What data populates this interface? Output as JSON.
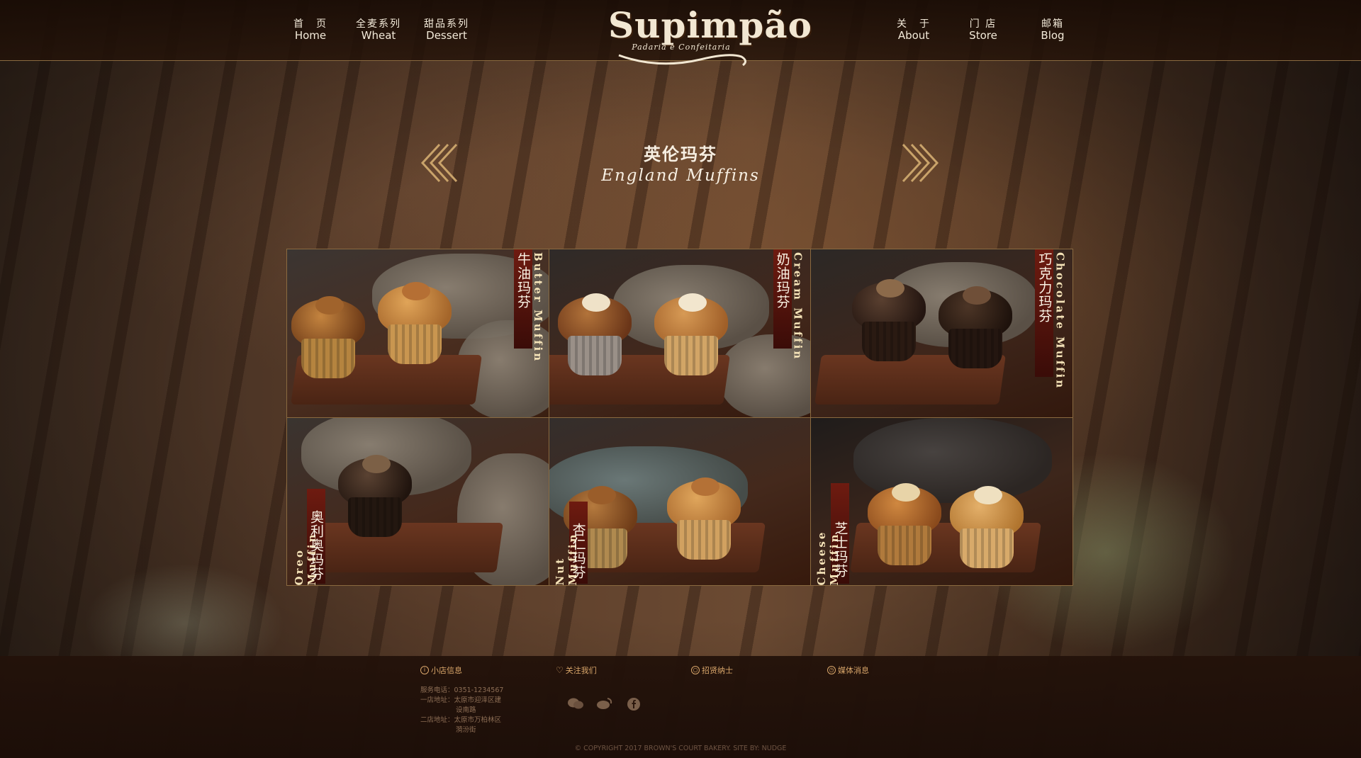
{
  "nav": {
    "left": [
      {
        "zh": "首　页",
        "en": "Home"
      },
      {
        "zh": "全麦系列",
        "en": "Wheat"
      },
      {
        "zh": "甜品系列",
        "en": "Dessert"
      }
    ],
    "right": [
      {
        "zh": "关　于",
        "en": "About"
      },
      {
        "zh": "门 店",
        "en": "Store"
      },
      {
        "zh": "邮箱",
        "en": "Blog"
      }
    ]
  },
  "logo": {
    "main": "Supimpão",
    "sub": "Padaria e Confeitaria"
  },
  "section": {
    "title_zh": "英伦玛芬",
    "title_en": "England Muffins"
  },
  "products": [
    {
      "zh": "牛油玛芬",
      "en": "Butter Muffin"
    },
    {
      "zh": "奶油玛芬",
      "en": "Cream Muffin"
    },
    {
      "zh": "巧克力玛芬",
      "en": "Chocolate Muffin"
    },
    {
      "zh": "奥利奥玛芬",
      "en": "Oreo Muffin"
    },
    {
      "zh": "杏仁玛芬",
      "en": "Nut Muffin"
    },
    {
      "zh": "芝士玛芬",
      "en": "Cheese Muffin"
    }
  ],
  "footer": {
    "headings": [
      "小店信息",
      "关注我们",
      "招贤纳士",
      "媒体消息"
    ],
    "phone": "服务电话：0351-1234567",
    "store1_label": "一店地址：太原市迎泽区建",
    "store1_cont": "设南路",
    "store2_label": "二店地址：太原市万柏林区",
    "store2_cont": "漪汾街",
    "copyright": "© COPYRIGHT 2017 BROWN'S COURT BAKERY. SITE BY: NUDGE",
    "social_icons": [
      "wechat-icon",
      "weibo-icon",
      "facebook-icon"
    ]
  },
  "colors": {
    "accent": "#c9a36a",
    "band": "#6e1b10",
    "footer_text": "#d9a66a"
  }
}
